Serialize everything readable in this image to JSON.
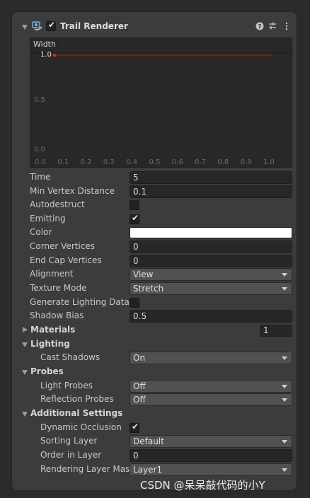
{
  "header": {
    "title": "Trail Renderer",
    "enabled": true,
    "buttons": [
      "help-icon",
      "presets-icon",
      "more-icon"
    ]
  },
  "curve": {
    "label": "Width",
    "y_top": "1.0",
    "y_mid": "0.5",
    "y_bottom": "0.0",
    "x_ticks": [
      "0.0",
      "0.1",
      "0.2",
      "0.3",
      "0.4",
      "0.5",
      "0.6",
      "0.7",
      "0.8",
      "0.9",
      "1.0"
    ],
    "line_color": "#8b1a1a",
    "value": 1.0
  },
  "properties": {
    "time": {
      "label": "Time",
      "value": "5"
    },
    "min_vertex": {
      "label": "Min Vertex Distance",
      "value": "0.1"
    },
    "autodestruct": {
      "label": "Autodestruct",
      "checked": false
    },
    "emitting": {
      "label": "Emitting",
      "checked": true
    },
    "color": {
      "label": "Color",
      "value": "#ffffff"
    },
    "corner": {
      "label": "Corner Vertices",
      "value": "0"
    },
    "endcap": {
      "label": "End Cap Vertices",
      "value": "0"
    },
    "alignment": {
      "label": "Alignment",
      "value": "View"
    },
    "texture_mode": {
      "label": "Texture Mode",
      "value": "Stretch"
    },
    "gen_lighting": {
      "label": "Generate Lighting Data",
      "checked": false
    },
    "shadow_bias": {
      "label": "Shadow Bias",
      "value": "0.5"
    }
  },
  "materials": {
    "label": "Materials",
    "size": "1",
    "expanded": false
  },
  "lighting": {
    "label": "Lighting",
    "cast_shadows": {
      "label": "Cast Shadows",
      "value": "On"
    }
  },
  "probes": {
    "label": "Probes",
    "light_probes": {
      "label": "Light Probes",
      "value": "Off"
    },
    "reflection_probes": {
      "label": "Reflection Probes",
      "value": "Off"
    }
  },
  "additional": {
    "label": "Additional Settings",
    "dynamic_occlusion": {
      "label": "Dynamic Occlusion",
      "checked": true
    },
    "sorting_layer": {
      "label": "Sorting Layer",
      "value": "Default"
    },
    "order_in_layer": {
      "label": "Order in Layer",
      "value": "0"
    },
    "rendering_layer_mask": {
      "label": "Rendering Layer Mask",
      "value": "Layer1"
    }
  },
  "watermark": "CSDN @呆呆敲代码的小Y"
}
